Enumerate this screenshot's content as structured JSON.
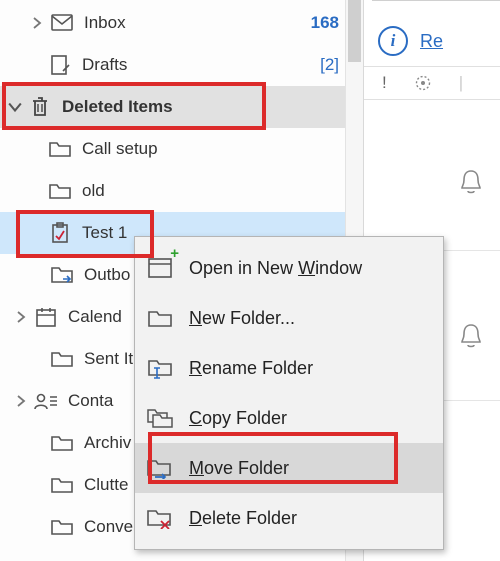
{
  "folders": {
    "inbox": {
      "label": "Inbox",
      "count": "168"
    },
    "drafts": {
      "label": "Drafts",
      "count": "[2]"
    },
    "deleted": {
      "label": "Deleted Items"
    },
    "deleted_children": {
      "call_setup": {
        "label": "Call setup"
      },
      "old": {
        "label": "old"
      },
      "test1": {
        "label": "Test 1"
      }
    },
    "outbox": {
      "label": "Outbo"
    },
    "calendar": {
      "label": "Calend"
    },
    "sent": {
      "label": "Sent It"
    },
    "contacts": {
      "label": "Conta"
    },
    "archive": {
      "label": "Archiv"
    },
    "clutter": {
      "label": "Clutte"
    },
    "conversations": {
      "label": "Conve"
    }
  },
  "context_menu": {
    "open_new_window": {
      "pre": "Open in New ",
      "u": "W",
      "post": "indow"
    },
    "new_folder": {
      "pre": "",
      "u": "N",
      "post": "ew Folder..."
    },
    "rename_folder": {
      "pre": "",
      "u": "R",
      "post": "ename Folder"
    },
    "copy_folder": {
      "pre": "",
      "u": "C",
      "post": "opy Folder"
    },
    "move_folder": {
      "pre": "",
      "u": "M",
      "post": "ove Folder"
    },
    "delete_folder": {
      "pre": "",
      "u": "D",
      "post": "elete Folder"
    }
  },
  "reading_pane": {
    "info_link": "Re",
    "flag_header": "!",
    "info_letter": "i"
  }
}
